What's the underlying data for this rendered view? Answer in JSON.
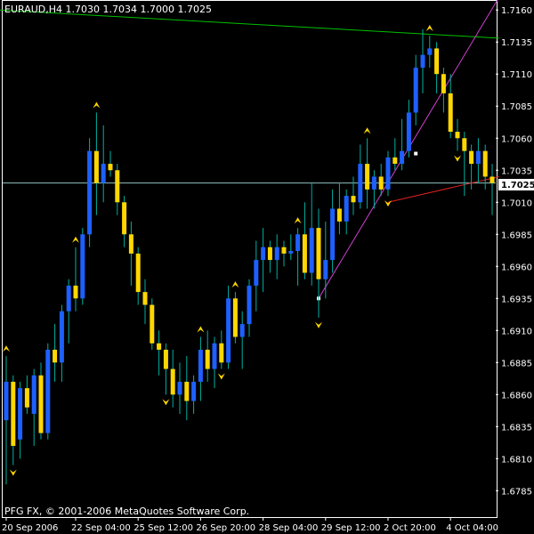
{
  "chart_data": {
    "type": "candlestick",
    "title": "EURAUD,H4  1.7030 1.7034 1.7000 1.7025",
    "copyright": "PFG FX, © 2001-2006 MetaQuotes Software Corp.",
    "current_price_label": "1.7025",
    "ylim": [
      1.677,
      1.7165
    ],
    "y_ticks": [
      "1.7160",
      "1.7135",
      "1.7110",
      "1.7085",
      "1.7060",
      "1.7035",
      "1.7010",
      "1.6985",
      "1.6960",
      "1.6935",
      "1.6910",
      "1.6885",
      "1.6860",
      "1.6835",
      "1.6810",
      "1.6785"
    ],
    "x_ticks": [
      {
        "label": "20 Sep 2006",
        "index": 0
      },
      {
        "label": "22 Sep 04:00",
        "index": 10
      },
      {
        "label": "25 Sep 12:00",
        "index": 19
      },
      {
        "label": "26 Sep 20:00",
        "index": 28
      },
      {
        "label": "28 Sep 04:00",
        "index": 37
      },
      {
        "label": "29 Sep 12:00",
        "index": 46
      },
      {
        "label": "2 Oct 20:00",
        "index": 55
      },
      {
        "label": "4 Oct 04:00",
        "index": 64
      }
    ],
    "grid": false,
    "colors": {
      "background": "#000000",
      "axis": "#ffffff",
      "bull": "#1e60ff",
      "bear": "#ffd700",
      "wick": "#00b0a0",
      "fractal": "#ffd700",
      "green_line": "#00c000",
      "magenta_line": "#d040d0",
      "red_line": "#e02020",
      "price_line": "#90c0c0",
      "current_label_bg": "#ffffff"
    },
    "candles": [
      {
        "o": 1.684,
        "h": 1.689,
        "l": 1.679,
        "c": 1.687
      },
      {
        "o": 1.687,
        "h": 1.6875,
        "l": 1.6805,
        "c": 1.682
      },
      {
        "o": 1.6825,
        "h": 1.687,
        "l": 1.681,
        "c": 1.6865
      },
      {
        "o": 1.6865,
        "h": 1.6875,
        "l": 1.6845,
        "c": 1.685
      },
      {
        "o": 1.6845,
        "h": 1.688,
        "l": 1.682,
        "c": 1.6875
      },
      {
        "o": 1.6875,
        "h": 1.6885,
        "l": 1.6825,
        "c": 1.683
      },
      {
        "o": 1.683,
        "h": 1.69,
        "l": 1.6825,
        "c": 1.6895
      },
      {
        "o": 1.6895,
        "h": 1.6915,
        "l": 1.687,
        "c": 1.6885
      },
      {
        "o": 1.6885,
        "h": 1.693,
        "l": 1.687,
        "c": 1.6925
      },
      {
        "o": 1.6925,
        "h": 1.695,
        "l": 1.69,
        "c": 1.6945
      },
      {
        "o": 1.6945,
        "h": 1.6975,
        "l": 1.6925,
        "c": 1.6935
      },
      {
        "o": 1.6935,
        "h": 1.699,
        "l": 1.693,
        "c": 1.6985
      },
      {
        "o": 1.6985,
        "h": 1.706,
        "l": 1.6975,
        "c": 1.705
      },
      {
        "o": 1.705,
        "h": 1.708,
        "l": 1.7,
        "c": 1.7025
      },
      {
        "o": 1.7025,
        "h": 1.707,
        "l": 1.701,
        "c": 1.704
      },
      {
        "o": 1.704,
        "h": 1.705,
        "l": 1.703,
        "c": 1.7035
      },
      {
        "o": 1.7035,
        "h": 1.704,
        "l": 1.7,
        "c": 1.701
      },
      {
        "o": 1.701,
        "h": 1.7015,
        "l": 1.6975,
        "c": 1.6985
      },
      {
        "o": 1.6985,
        "h": 1.6995,
        "l": 1.6945,
        "c": 1.697
      },
      {
        "o": 1.697,
        "h": 1.6975,
        "l": 1.693,
        "c": 1.694
      },
      {
        "o": 1.694,
        "h": 1.695,
        "l": 1.6915,
        "c": 1.693
      },
      {
        "o": 1.693,
        "h": 1.6935,
        "l": 1.6895,
        "c": 1.69
      },
      {
        "o": 1.69,
        "h": 1.691,
        "l": 1.6875,
        "c": 1.6895
      },
      {
        "o": 1.6895,
        "h": 1.69,
        "l": 1.686,
        "c": 1.688
      },
      {
        "o": 1.688,
        "h": 1.6895,
        "l": 1.685,
        "c": 1.686
      },
      {
        "o": 1.686,
        "h": 1.6885,
        "l": 1.6845,
        "c": 1.687
      },
      {
        "o": 1.687,
        "h": 1.689,
        "l": 1.684,
        "c": 1.6855
      },
      {
        "o": 1.6855,
        "h": 1.6875,
        "l": 1.6845,
        "c": 1.687
      },
      {
        "o": 1.687,
        "h": 1.6905,
        "l": 1.6855,
        "c": 1.6895
      },
      {
        "o": 1.6895,
        "h": 1.691,
        "l": 1.687,
        "c": 1.688
      },
      {
        "o": 1.688,
        "h": 1.6905,
        "l": 1.6865,
        "c": 1.69
      },
      {
        "o": 1.69,
        "h": 1.691,
        "l": 1.688,
        "c": 1.6885
      },
      {
        "o": 1.6885,
        "h": 1.6945,
        "l": 1.688,
        "c": 1.6935
      },
      {
        "o": 1.6935,
        "h": 1.694,
        "l": 1.69,
        "c": 1.6905
      },
      {
        "o": 1.6905,
        "h": 1.6925,
        "l": 1.688,
        "c": 1.6915
      },
      {
        "o": 1.6915,
        "h": 1.695,
        "l": 1.6905,
        "c": 1.6945
      },
      {
        "o": 1.6945,
        "h": 1.698,
        "l": 1.6925,
        "c": 1.6965
      },
      {
        "o": 1.6965,
        "h": 1.699,
        "l": 1.694,
        "c": 1.6975
      },
      {
        "o": 1.6975,
        "h": 1.698,
        "l": 1.6955,
        "c": 1.6965
      },
      {
        "o": 1.6965,
        "h": 1.6985,
        "l": 1.695,
        "c": 1.6975
      },
      {
        "o": 1.6975,
        "h": 1.698,
        "l": 1.696,
        "c": 1.697
      },
      {
        "o": 1.697,
        "h": 1.6985,
        "l": 1.6965,
        "c": 1.6972
      },
      {
        "o": 1.6972,
        "h": 1.699,
        "l": 1.6945,
        "c": 1.6985
      },
      {
        "o": 1.6985,
        "h": 1.701,
        "l": 1.695,
        "c": 1.6955
      },
      {
        "o": 1.6955,
        "h": 1.7025,
        "l": 1.6945,
        "c": 1.699
      },
      {
        "o": 1.699,
        "h": 1.7005,
        "l": 1.692,
        "c": 1.695
      },
      {
        "o": 1.695,
        "h": 1.6995,
        "l": 1.6935,
        "c": 1.6965
      },
      {
        "o": 1.6965,
        "h": 1.702,
        "l": 1.6955,
        "c": 1.7005
      },
      {
        "o": 1.7005,
        "h": 1.7025,
        "l": 1.6985,
        "c": 1.6995
      },
      {
        "o": 1.6995,
        "h": 1.702,
        "l": 1.6985,
        "c": 1.7015
      },
      {
        "o": 1.7015,
        "h": 1.703,
        "l": 1.7,
        "c": 1.701
      },
      {
        "o": 1.701,
        "h": 1.7055,
        "l": 1.7005,
        "c": 1.704
      },
      {
        "o": 1.704,
        "h": 1.706,
        "l": 1.7005,
        "c": 1.702
      },
      {
        "o": 1.702,
        "h": 1.7035,
        "l": 1.7005,
        "c": 1.703
      },
      {
        "o": 1.703,
        "h": 1.704,
        "l": 1.7015,
        "c": 1.702
      },
      {
        "o": 1.702,
        "h": 1.705,
        "l": 1.7015,
        "c": 1.7045
      },
      {
        "o": 1.7045,
        "h": 1.706,
        "l": 1.7035,
        "c": 1.704
      },
      {
        "o": 1.704,
        "h": 1.7075,
        "l": 1.7035,
        "c": 1.705
      },
      {
        "o": 1.705,
        "h": 1.709,
        "l": 1.7045,
        "c": 1.708
      },
      {
        "o": 1.708,
        "h": 1.7125,
        "l": 1.707,
        "c": 1.7115
      },
      {
        "o": 1.7115,
        "h": 1.7145,
        "l": 1.7095,
        "c": 1.7125
      },
      {
        "o": 1.7125,
        "h": 1.714,
        "l": 1.7115,
        "c": 1.713
      },
      {
        "o": 1.713,
        "h": 1.7135,
        "l": 1.7095,
        "c": 1.711
      },
      {
        "o": 1.711,
        "h": 1.7115,
        "l": 1.708,
        "c": 1.7095
      },
      {
        "o": 1.7095,
        "h": 1.711,
        "l": 1.706,
        "c": 1.7065
      },
      {
        "o": 1.7065,
        "h": 1.7075,
        "l": 1.705,
        "c": 1.706
      },
      {
        "o": 1.706,
        "h": 1.7065,
        "l": 1.7015,
        "c": 1.705
      },
      {
        "o": 1.705,
        "h": 1.7055,
        "l": 1.702,
        "c": 1.704
      },
      {
        "o": 1.704,
        "h": 1.706,
        "l": 1.7025,
        "c": 1.705
      },
      {
        "o": 1.705,
        "h": 1.7055,
        "l": 1.702,
        "c": 1.703
      },
      {
        "o": 1.703,
        "h": 1.704,
        "l": 1.7,
        "c": 1.7025
      }
    ],
    "fractals_up": [
      0,
      10,
      13,
      28,
      33,
      42,
      52,
      61
    ],
    "fractals_down": [
      1,
      23,
      31,
      45,
      55,
      65
    ],
    "trendlines": [
      {
        "name": "green",
        "x1": -1,
        "y1": 1.716,
        "x2": 71,
        "y2": 1.7138
      },
      {
        "name": "magenta",
        "x1": 45,
        "y1": 1.6935,
        "x2": 71,
        "y2": 1.717
      },
      {
        "name": "red",
        "x1": 55,
        "y1": 1.701,
        "x2": 71,
        "y2": 1.703
      }
    ],
    "horizontal_price": 1.7025
  }
}
